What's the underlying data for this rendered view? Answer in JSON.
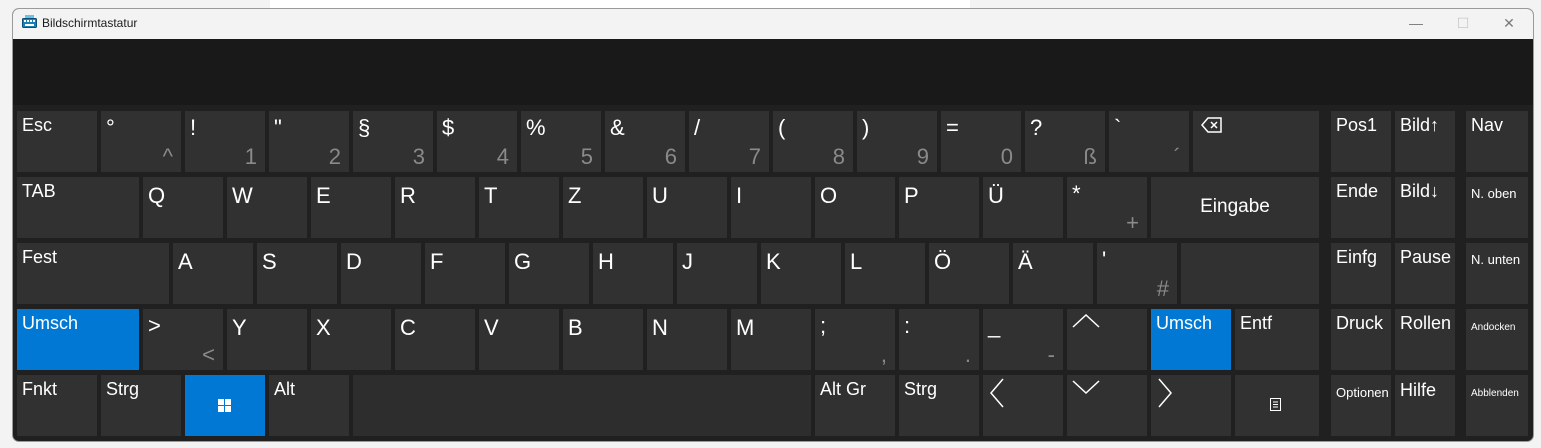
{
  "window": {
    "title": "Bildschirmtastatur",
    "controls": {
      "minimize": "—",
      "maximize": "☐",
      "close": "✕"
    }
  },
  "keys": {
    "esc": "Esc",
    "deg": {
      "top": "°",
      "bottom": "^"
    },
    "n1": {
      "top": "!",
      "bottom": "1"
    },
    "n2": {
      "top": "\"",
      "bottom": "2"
    },
    "n3": {
      "top": "§",
      "bottom": "3"
    },
    "n4": {
      "top": "$",
      "bottom": "4"
    },
    "n5": {
      "top": "%",
      "bottom": "5"
    },
    "n6": {
      "top": "&",
      "bottom": "6"
    },
    "n7": {
      "top": "/",
      "bottom": "7"
    },
    "n8": {
      "top": "(",
      "bottom": "8"
    },
    "n9": {
      "top": ")",
      "bottom": "9"
    },
    "n0": {
      "top": "=",
      "bottom": "0"
    },
    "ss": {
      "top": "?",
      "bottom": "ß"
    },
    "acc": {
      "top": "`",
      "bottom": "´"
    },
    "tab": "TAB",
    "q": "Q",
    "w": "W",
    "e": "E",
    "r": "R",
    "t": "T",
    "z": "Z",
    "u": "U",
    "i": "I",
    "o": "O",
    "p": "P",
    "ue": "Ü",
    "plus": {
      "top": "*",
      "bottom": "+"
    },
    "enter": "Eingabe",
    "fest": "Fest",
    "a": "A",
    "s": "S",
    "d": "D",
    "f": "F",
    "g": "G",
    "h": "H",
    "j": "J",
    "k": "K",
    "l": "L",
    "oe": "Ö",
    "ae": "Ä",
    "hash": {
      "top": "'",
      "bottom": "#"
    },
    "lshift": "Umsch",
    "lt": {
      "top": ">",
      "bottom": "<"
    },
    "y": "Y",
    "x": "X",
    "c": "C",
    "v": "V",
    "b": "B",
    "n": "N",
    "m": "M",
    "comma": {
      "top": ";",
      "bottom": ","
    },
    "period": {
      "top": ":",
      "bottom": "."
    },
    "minus": {
      "top": "_",
      "bottom": "-"
    },
    "rshift": "Umsch",
    "entf": "Entf",
    "fnkt": "Fnkt",
    "strg": "Strg",
    "alt": "Alt",
    "altgr": "Alt Gr",
    "rstrg": "Strg",
    "pos1": "Pos1",
    "pgup": "Bild↑",
    "nav": "Nav",
    "ende": "Ende",
    "pgdn": "Bild↓",
    "noben": "N. oben",
    "einfg": "Einfg",
    "pause": "Pause",
    "nunten": "N. unten",
    "druck": "Druck",
    "rollen": "Rollen",
    "andocken": "Andocken",
    "optionen": "Optionen",
    "hilfe": "Hilfe",
    "abblenden": "Abblenden"
  },
  "colors": {
    "accent": "#0078d4",
    "key": "#313131",
    "panel": "#202020"
  }
}
